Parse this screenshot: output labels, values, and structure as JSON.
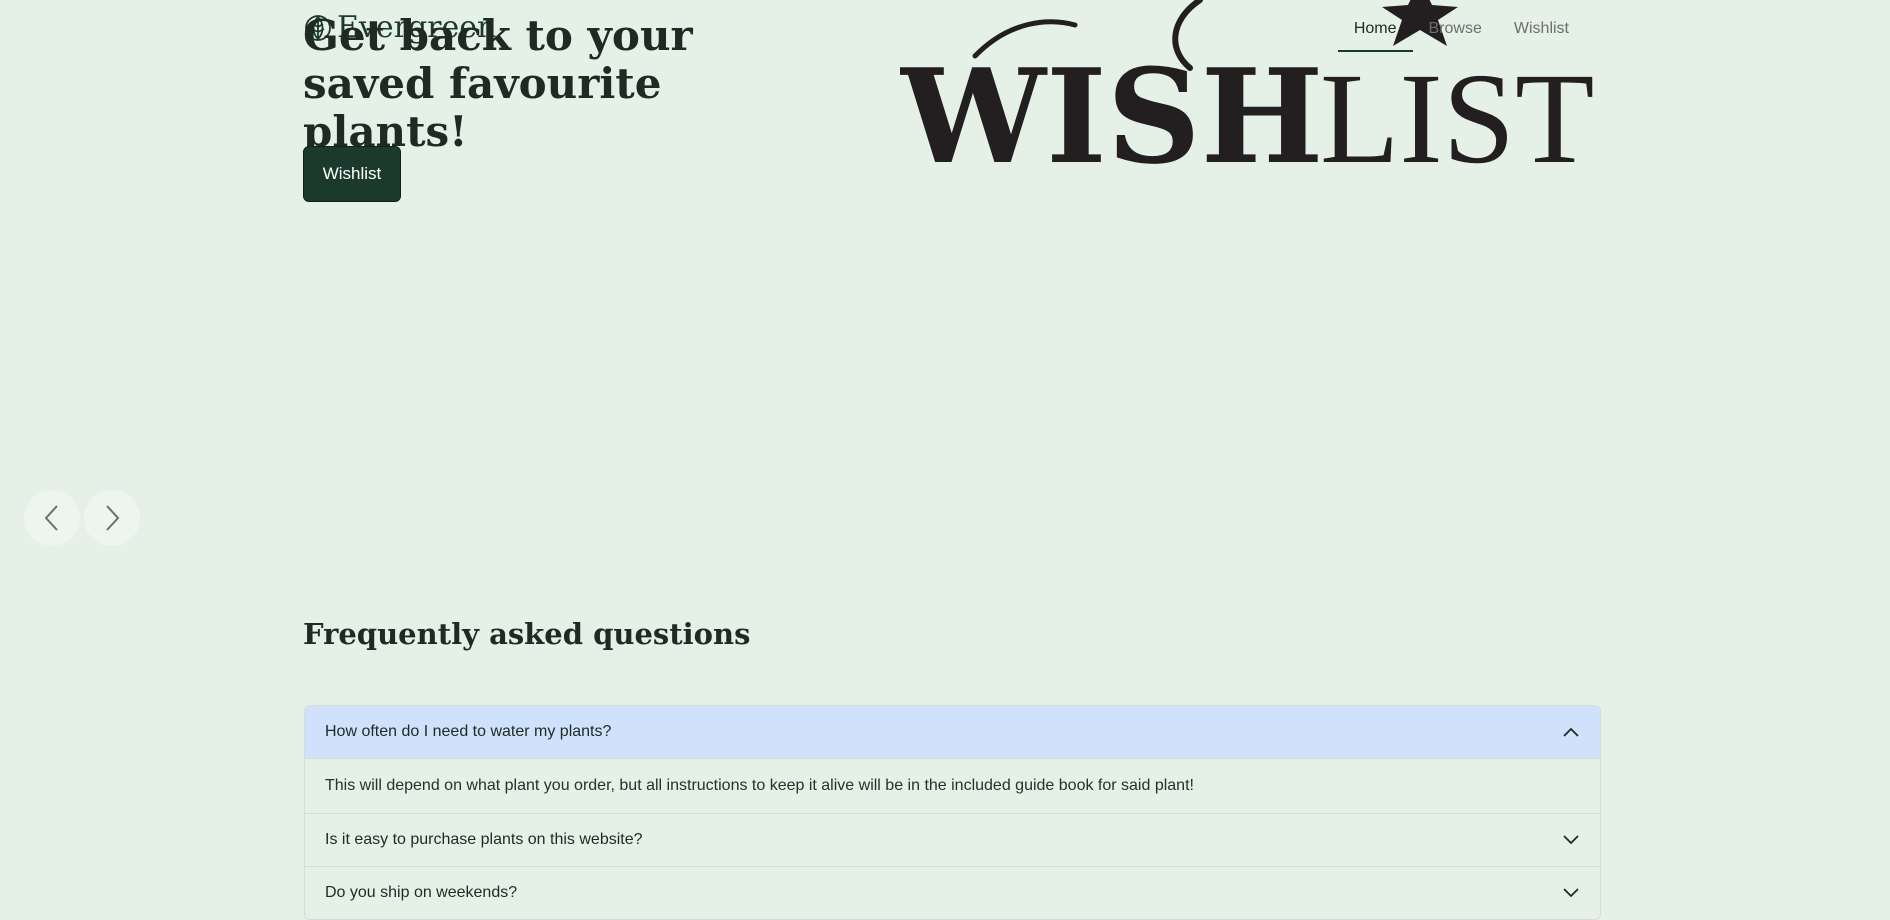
{
  "brand": {
    "name": "Evergreen",
    "icon": "leaf-icon"
  },
  "nav": {
    "items": [
      "Home",
      "Browse",
      "Wishlist"
    ],
    "active": "Home"
  },
  "hero": {
    "title": "Get back to your saved favourite plants!",
    "button_label": "Wishlist",
    "art_text": {
      "bold": "WISH",
      "light": "LIST"
    }
  },
  "carousel": {
    "prev_icon": "chevron-left-icon",
    "next_icon": "chevron-right-icon"
  },
  "faq": {
    "heading": "Frequently asked questions",
    "items": [
      {
        "question": "How often do I need to water my plants?",
        "answer": "This will depend on what plant you order, but all instructions to keep it alive will be in the included guide book for said plant!",
        "expanded": true
      },
      {
        "question": "Is it easy to purchase plants on this website?",
        "expanded": false
      },
      {
        "question": "Do you ship on weekends?",
        "expanded": false
      }
    ]
  },
  "colors": {
    "background": "#e5f0e7",
    "primary": "#1b3a2d",
    "accordion_active": "#cfe1fb"
  }
}
